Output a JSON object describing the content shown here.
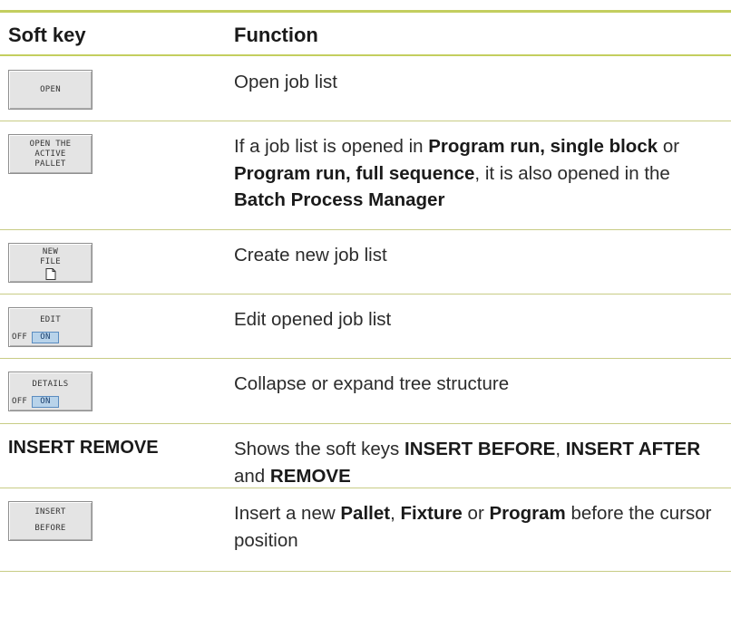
{
  "header": {
    "col1": "Soft key",
    "col2": "Function"
  },
  "rows": [
    {
      "key_lines": [
        "OPEN"
      ],
      "fn": [
        {
          "t": "Open job list"
        }
      ]
    },
    {
      "key_lines": [
        "OPEN THE",
        "ACTIVE",
        "PALLET"
      ],
      "fn": [
        {
          "t": "If a job list is opened in "
        },
        {
          "t": "Program run, single block",
          "b": true
        },
        {
          "t": " or "
        },
        {
          "t": "Program run, full sequence",
          "b": true
        },
        {
          "t": ", it is also opened in the "
        },
        {
          "t": "Batch Process Manager",
          "b": true
        }
      ]
    },
    {
      "key_lines": [
        "NEW",
        "FILE"
      ],
      "icon": "new-file-icon",
      "fn": [
        {
          "t": "Create new job list"
        }
      ]
    },
    {
      "key_lines": [
        "EDIT"
      ],
      "toggle": {
        "off": "OFF",
        "on": "ON"
      },
      "fn": [
        {
          "t": "Edit opened job list"
        }
      ]
    },
    {
      "key_lines": [
        "DETAILS"
      ],
      "toggle": {
        "off": "OFF",
        "on": "ON"
      },
      "fn": [
        {
          "t": "Collapse or expand tree structure"
        }
      ]
    },
    {
      "plain_key": "INSERT REMOVE",
      "fn": [
        {
          "t": "Shows the soft keys "
        },
        {
          "t": "INSERT BEFORE",
          "b": true
        },
        {
          "t": ", "
        },
        {
          "t": "INSERT AFTER",
          "b": true
        },
        {
          "t": " and "
        },
        {
          "t": "REMOVE",
          "b": true
        }
      ]
    },
    {
      "key_lines": [
        "INSERT",
        "BEFORE"
      ],
      "spread": true,
      "fn": [
        {
          "t": "Insert a new "
        },
        {
          "t": "Pallet",
          "b": true
        },
        {
          "t": ", "
        },
        {
          "t": "Fixture",
          "b": true
        },
        {
          "t": " or "
        },
        {
          "t": "Program",
          "b": true
        },
        {
          "t": " before the cursor position"
        }
      ]
    }
  ]
}
